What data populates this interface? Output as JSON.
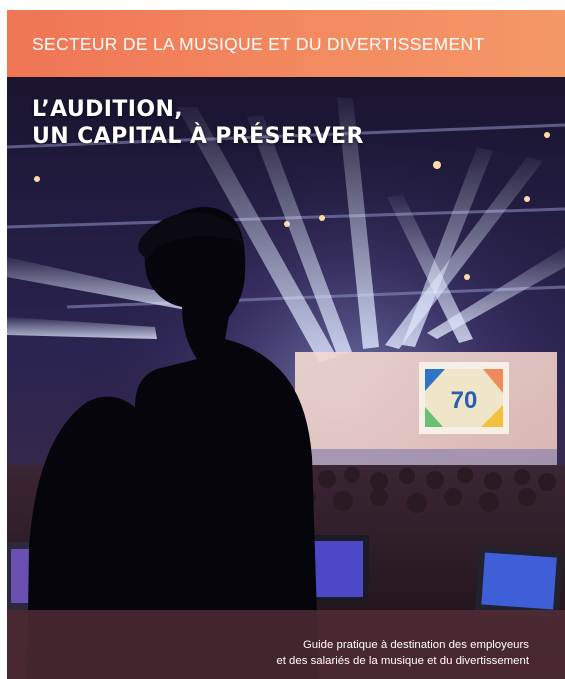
{
  "cover": {
    "header": "SECTEUR DE LA MUSIQUE ET DU DIVERTISSEMENT",
    "title_line1": "L’AUDITION,",
    "title_line2": "UN CAPITAL À PRÉSERVER",
    "subtitle_line1": "Guide pratique à destination des employeurs",
    "subtitle_line2": "et des salariés de la musique et du divertissement",
    "screen_logo_number": "70"
  },
  "colors": {
    "header_band": "#f07555",
    "footer_band": "#542e38",
    "text": "#ffffff",
    "stage_lights": "#c9d8ff"
  }
}
